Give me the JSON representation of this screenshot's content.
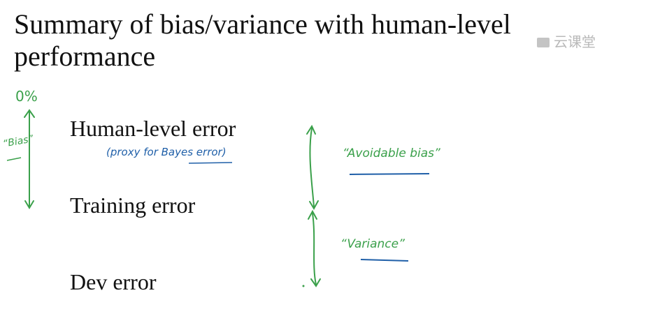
{
  "slide": {
    "title_line1": "Summary of bias/variance with human-level",
    "title_line2": "performance",
    "labels": {
      "human_level_error": "Human-level error",
      "training_error": "Training error",
      "dev_error": "Dev error"
    },
    "annotations": {
      "proxy": "(proxy for Bayes error)",
      "avoidable_bias": "“Avoidable bias”",
      "variance": "“Variance”",
      "zero_percent": "0%",
      "bias": "“Bias”"
    },
    "watermark": "云课堂"
  },
  "colors": {
    "ink_green": "#3aa04a",
    "ink_blue": "#1f5fa8",
    "text": "#111111",
    "watermark": "#b9b9b9"
  }
}
